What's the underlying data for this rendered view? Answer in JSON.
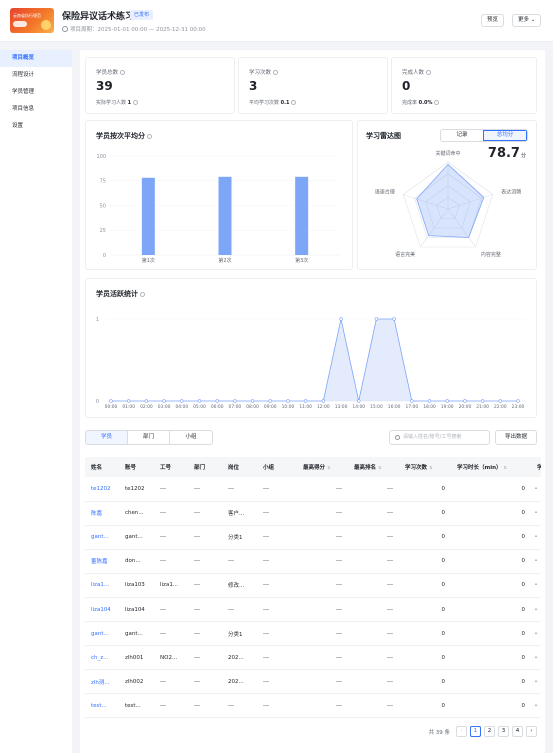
{
  "header": {
    "thumbnail_text": "云南省执行规范",
    "title": "保险异议话术练习",
    "status_badge": "已发布",
    "period_label": "项目周期：",
    "period_value": "2025-01-01 00:00 — 2025-12-31 00:00",
    "preview_label": "预览",
    "more_label": "更多"
  },
  "sidebar": {
    "items": [
      {
        "label": "项目概览",
        "active": true
      },
      {
        "label": "流程设计",
        "active": false
      },
      {
        "label": "学员管理",
        "active": false
      },
      {
        "label": "项目信息",
        "active": false
      },
      {
        "label": "设置",
        "active": false
      }
    ]
  },
  "stats": [
    {
      "label": "学员总数",
      "value": "39",
      "sub_label": "实际学习人数",
      "sub_value": "1"
    },
    {
      "label": "学习次数",
      "value": "3",
      "sub_label": "平均学习次数",
      "sub_value": "0.1"
    },
    {
      "label": "完成人数",
      "value": "0",
      "sub_label": "完成率",
      "sub_value": "0.0%"
    }
  ],
  "bar_card": {
    "title": "学员按次平均分"
  },
  "radar_card": {
    "title": "学习雷达图",
    "tab_record": "记录",
    "tab_avg": "总均分",
    "score": "78.7",
    "score_unit": "分"
  },
  "activity_card": {
    "title": "学员活跃统计"
  },
  "chart_data": [
    {
      "type": "bar",
      "categories": [
        "第1次",
        "第2次",
        "第3次"
      ],
      "values": [
        78,
        79,
        79
      ],
      "ylim": [
        0,
        100
      ],
      "yticks": [
        0,
        25,
        50,
        75,
        100
      ],
      "grid": true,
      "color": "#7ea6f8"
    },
    {
      "type": "radar",
      "axes": [
        "关键词命中",
        "表达流畅",
        "内容完整",
        "语言完美",
        "语速合理"
      ],
      "values": [
        95,
        80,
        75,
        70,
        70
      ],
      "max": 100,
      "total_score": 78.7,
      "color": "#7ea6f8"
    },
    {
      "type": "area",
      "categories": [
        "00:00",
        "01:00",
        "02:00",
        "03:00",
        "04:00",
        "05:00",
        "06:00",
        "07:00",
        "08:00",
        "09:00",
        "10:00",
        "11:00",
        "12:00",
        "13:00",
        "14:00",
        "15:00",
        "16:00",
        "17:00",
        "18:00",
        "19:00",
        "20:00",
        "21:00",
        "22:00",
        "23:00"
      ],
      "values": [
        0,
        0,
        0,
        0,
        0,
        0,
        0,
        0,
        0,
        0,
        0,
        0,
        0,
        1,
        0,
        1,
        1,
        0,
        0,
        0,
        0,
        0,
        0,
        0
      ],
      "ylim": [
        0,
        1
      ],
      "yticks": [
        0,
        1
      ],
      "grid": true,
      "color": "#7ea6f8"
    }
  ],
  "filters": {
    "tabs": [
      "学员",
      "部门",
      "小组"
    ],
    "active_tab": "学员",
    "search_placeholder": "请输入姓名/账号/工号搜索",
    "export_label": "导出数据"
  },
  "table": {
    "columns": [
      "姓名",
      "账号",
      "工号",
      "部门",
      "岗位",
      "小组",
      "最高得分",
      "最高排名",
      "学习次数",
      "学习时长（min）",
      "学"
    ],
    "rows": [
      [
        "te1202",
        "te1202",
        "---",
        "---",
        "---",
        "---",
        "---",
        "---",
        "0",
        "0"
      ],
      [
        "陈嘉",
        "chen...",
        "---",
        "---",
        "客户...",
        "---",
        "---",
        "---",
        "0",
        "0"
      ],
      [
        "gant...",
        "gant...",
        "---",
        "---",
        "分类1",
        "---",
        "---",
        "---",
        "0",
        "0"
      ],
      [
        "董陈嘉",
        "don...",
        "---",
        "---",
        "---",
        "---",
        "---",
        "---",
        "0",
        "0"
      ],
      [
        "liza1...",
        "liza103",
        "liza1...",
        "---",
        "修改...",
        "---",
        "---",
        "---",
        "0",
        "0"
      ],
      [
        "liza104",
        "liza104",
        "---",
        "---",
        "---",
        "---",
        "---",
        "---",
        "0",
        "0"
      ],
      [
        "gant...",
        "gant...",
        "---",
        "---",
        "分类1",
        "---",
        "---",
        "---",
        "0",
        "0"
      ],
      [
        "ch_z...",
        "zlh001",
        "NO2...",
        "---",
        "202...",
        "---",
        "---",
        "---",
        "0",
        "0"
      ],
      [
        "zlh测...",
        "zlh002",
        "---",
        "---",
        "202...",
        "---",
        "---",
        "---",
        "0",
        "0"
      ],
      [
        "test...",
        "test...",
        "---",
        "---",
        "---",
        "---",
        "---",
        "---",
        "0",
        "0"
      ]
    ]
  },
  "pagination": {
    "total_text": "共 39 条",
    "pages": [
      "1",
      "2",
      "3",
      "4"
    ],
    "current": "1",
    "prev": "‹",
    "next": "›"
  }
}
